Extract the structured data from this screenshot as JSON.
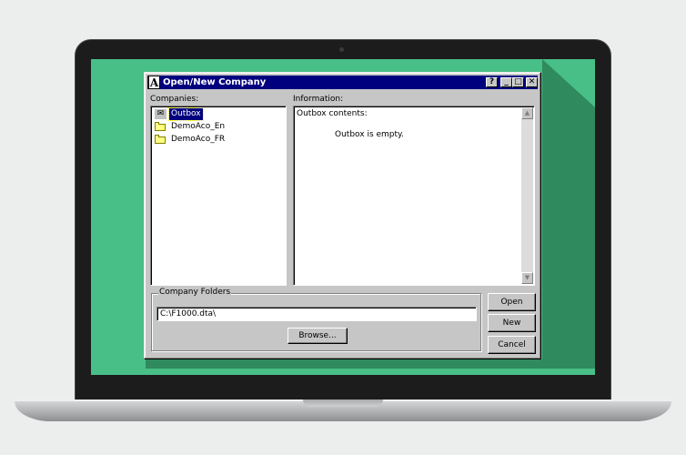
{
  "dialog": {
    "title": "Open/New Company",
    "app_icon_letter": "A",
    "help_glyph": "?",
    "minimize_glyph": "_",
    "maximize_glyph": "□",
    "close_glyph": "✕"
  },
  "companies": {
    "label": "Companies:",
    "items": [
      {
        "label": "Outbox",
        "icon": "outbox-icon",
        "selected": true
      },
      {
        "label": "DemoAco_En",
        "icon": "folder-icon",
        "selected": false
      },
      {
        "label": "DemoAco_FR",
        "icon": "folder-icon",
        "selected": false
      }
    ]
  },
  "information": {
    "label": "Information:",
    "heading": "Outbox contents:",
    "message": "Outbox is empty.",
    "scroll_up_glyph": "▲",
    "scroll_down_glyph": "▼"
  },
  "company_folders": {
    "label": "Company Folders",
    "path_value": "C:\\F1000.dta\\",
    "browse_label": "Browse..."
  },
  "buttons": {
    "open_label": "Open",
    "new_label": "New",
    "cancel_label": "Cancel"
  },
  "colors": {
    "screen_bg": "#48bf87",
    "titlebar": "#00007f",
    "dialog_face": "#c6c6c6"
  }
}
